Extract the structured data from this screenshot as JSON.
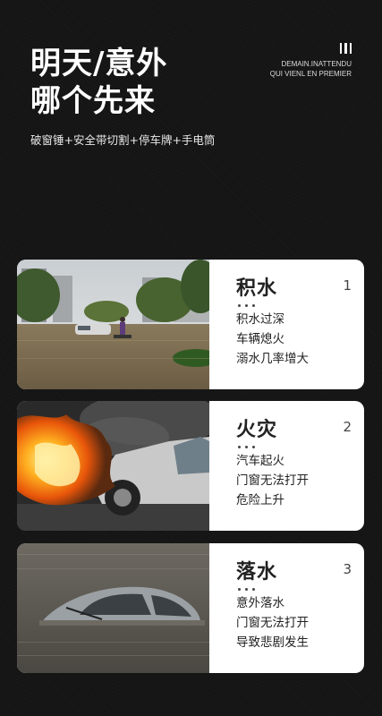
{
  "header": {
    "title_line1": "明天/意外",
    "title_line2": "哪个先来",
    "subtitle": "破窗锤+安全带切割+停车牌+手电筒",
    "brand_line1": "DEMAIN.INATTENDU",
    "brand_line2": "QUI VIENL EN PREMIER",
    "brand_icon": "three-bars-icon"
  },
  "cards": [
    {
      "name": "积水",
      "number": "1",
      "lines": [
        "积水过深",
        "车辆熄火",
        "溺水几率增大"
      ],
      "photo": "flooded-street-photo"
    },
    {
      "name": "火灾",
      "number": "2",
      "lines": [
        "汽车起火",
        "门窗无法打开",
        "危险上升"
      ],
      "photo": "burning-car-photo"
    },
    {
      "name": "落水",
      "number": "3",
      "lines": [
        "意外落水",
        "门窗无法打开",
        "导致悲剧发生"
      ],
      "photo": "submerged-car-photo"
    }
  ]
}
